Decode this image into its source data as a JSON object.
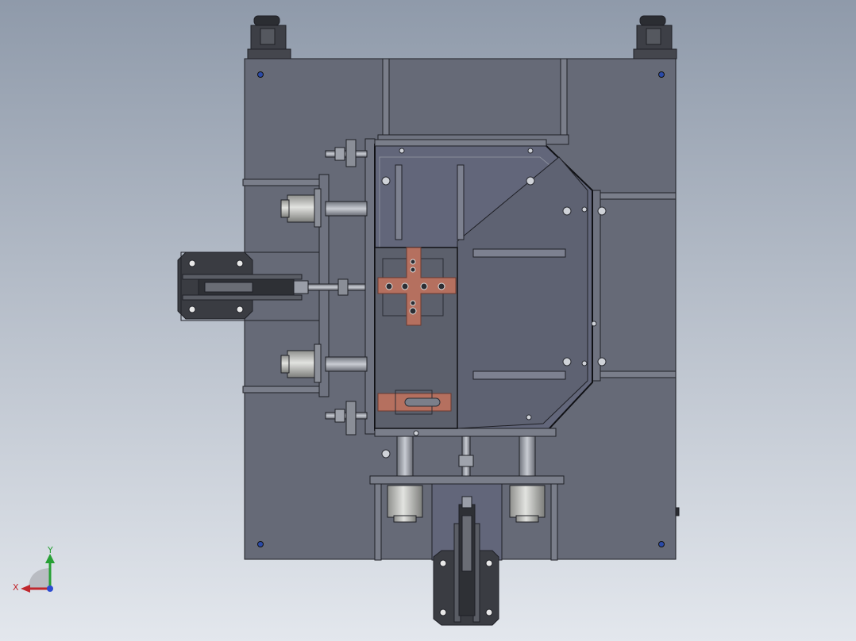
{
  "viewport": {
    "background_top": "#8f9aaa",
    "background_bottom": "#e3e7ed"
  },
  "colors": {
    "plate": "#666a77",
    "plate_dark": "#5d606c",
    "edge": "#1f2026",
    "light_edge": "#a9adb8",
    "copper": "#b5705f",
    "copper_edge": "#6a3a30",
    "rod": "#9a9ea8",
    "cylinder": "#c8c9c6",
    "bolt_blue": "#2a4aa8",
    "clamp_dark": "#3a3c42"
  },
  "triad": {
    "x_label": "X",
    "y_label": "Y",
    "x_axis_color": "#c0272d",
    "y_axis_color": "#27a035",
    "z_dot_color": "#2c4bd1",
    "icon": "triad-icon"
  },
  "model": {
    "name_icon": "fixture-assembly-icon",
    "view": "top"
  }
}
